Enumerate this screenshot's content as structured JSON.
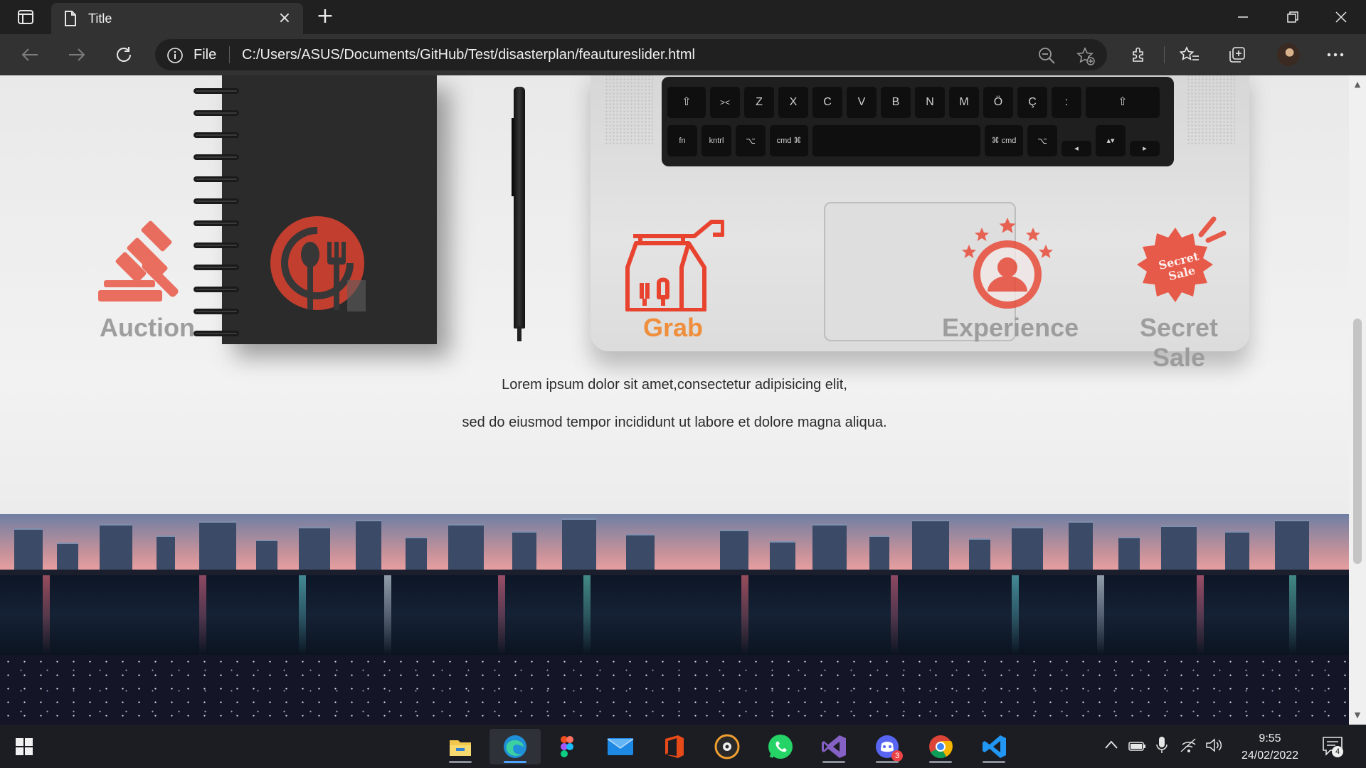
{
  "browser": {
    "tab_title": "Title",
    "new_tab_symbol": "+",
    "close_tab_symbol": "×",
    "address_scheme_label": "File",
    "address_url": "C:/Users/ASUS/Documents/GitHub/Test/disasterplan/feautureslider.html"
  },
  "features": [
    {
      "label": "Auction",
      "icon": "gavel-icon",
      "active": false
    },
    {
      "label": "",
      "icon": "restaurant-icon",
      "active": false
    },
    {
      "label": "Grab",
      "icon": "takeaway-bag-icon",
      "active": true
    },
    {
      "label": "Experience",
      "icon": "star-user-icon",
      "active": false
    },
    {
      "label": "Secret Sale",
      "icon": "secret-sale-badge-icon",
      "active": false
    }
  ],
  "secret_sale_badge_text": "Secret Sale",
  "lorem_lines": [
    "Lorem ipsum dolor sit amet,consectetur adipisicing elit,",
    "sed do eiusmod tempor incididunt ut labore et dolore magna aliqua."
  ],
  "keyboard": {
    "row1": [
      "⇧",
      "><",
      "Z",
      "X",
      "C",
      "V",
      "B",
      "N",
      "M",
      "Ö",
      "Ç",
      ":",
      "⇧"
    ],
    "row2": [
      "fn",
      "kntrl",
      "⌥",
      "cmd ⌘",
      "",
      "⌘ cmd",
      "⌥",
      "◂",
      "▴▾",
      "▸"
    ]
  },
  "taskbar": {
    "time": "9:55",
    "date": "24/02/2022",
    "discord_badge": "3",
    "notification_count": "4",
    "apps": [
      "start-icon",
      "file-explorer-icon",
      "edge-icon",
      "figma-icon",
      "mail-icon",
      "office-icon",
      "music-player-icon",
      "whatsapp-icon",
      "visual-studio-icon",
      "discord-icon",
      "chrome-icon",
      "vscode-icon"
    ]
  },
  "colors": {
    "accent_orange": "#f08a34",
    "icon_red": "#e8432f",
    "inactive_label": "#9a9a9a",
    "chrome_dark": "#202020"
  }
}
